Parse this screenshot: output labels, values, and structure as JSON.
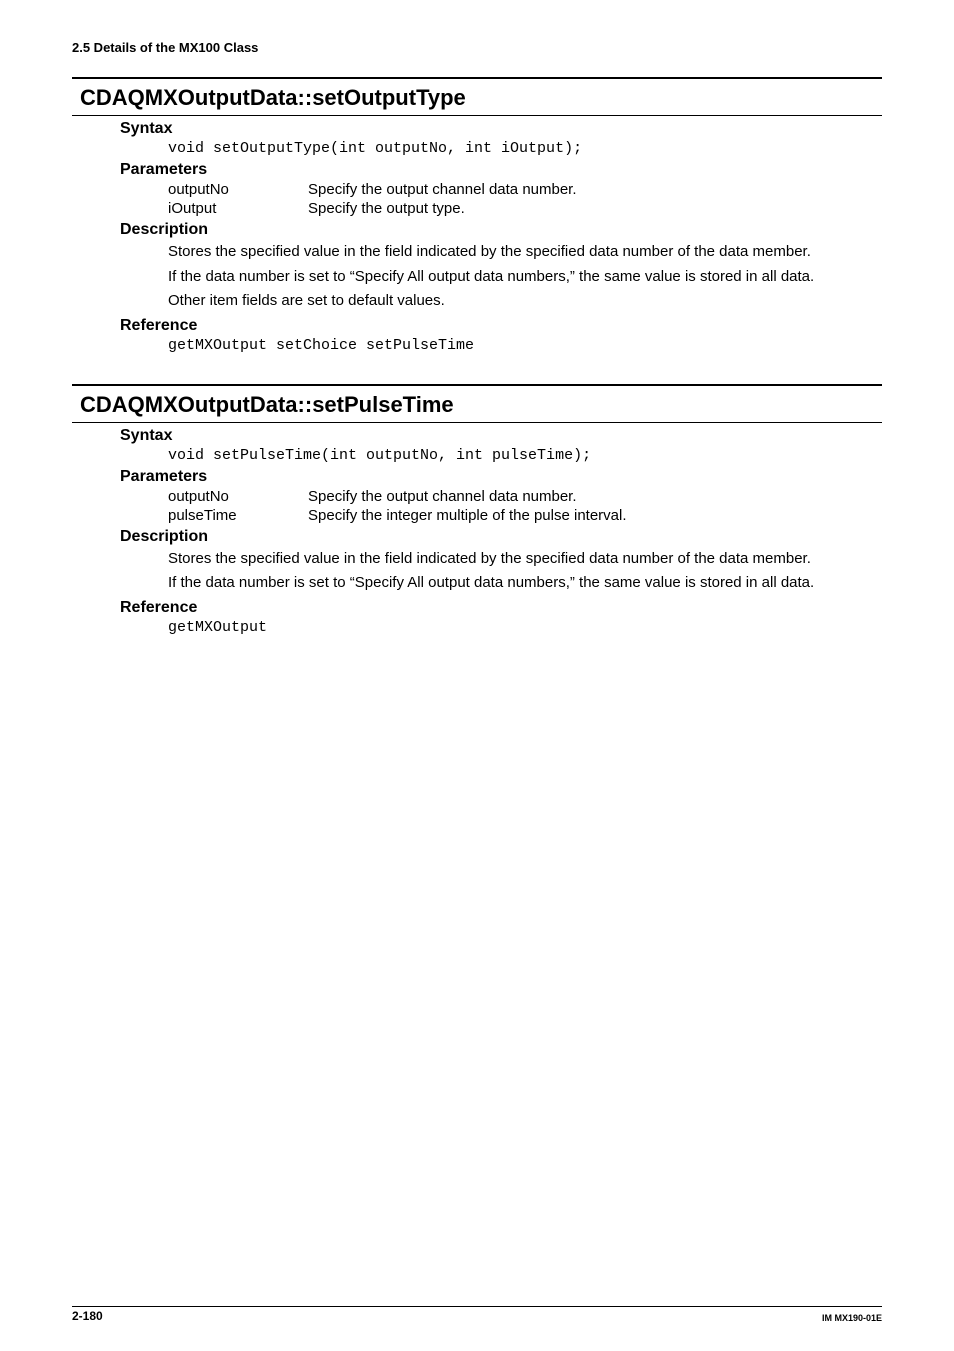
{
  "header": {
    "section": "2.5  Details of the MX100 Class"
  },
  "entries": [
    {
      "title": "CDAQMXOutputData::setOutputType",
      "syntax_label": "Syntax",
      "syntax_code": "void setOutputType(int outputNo, int iOutput);",
      "params_label": "Parameters",
      "params": [
        {
          "name": "outputNo",
          "desc": "Specify the output channel data number."
        },
        {
          "name": "iOutput",
          "desc": "Specify the output type."
        }
      ],
      "desc_label": "Description",
      "desc_paras": [
        "Stores the specified value in the field indicated by the specified data number of the data member.",
        "If the data number is set to “Specify All output data numbers,” the same value is stored in all data.",
        "Other item fields are set to default values."
      ],
      "ref_label": "Reference",
      "ref_code": "getMXOutput setChoice setPulseTime"
    },
    {
      "title": "CDAQMXOutputData::setPulseTime",
      "syntax_label": "Syntax",
      "syntax_code": "void setPulseTime(int outputNo, int pulseTime);",
      "params_label": "Parameters",
      "params": [
        {
          "name": "outputNo",
          "desc": "Specify the output channel data number."
        },
        {
          "name": "pulseTime",
          "desc": "Specify the integer multiple of the pulse interval."
        }
      ],
      "desc_label": "Description",
      "desc_paras": [
        "Stores the specified value in the field indicated by the specified data number of the data member.",
        "If the data number is set to “Specify All output data numbers,” the same value is stored in all data."
      ],
      "ref_label": "Reference",
      "ref_code": "getMXOutput"
    }
  ],
  "footer": {
    "page": "2-180",
    "docid": "IM MX190-01E"
  }
}
